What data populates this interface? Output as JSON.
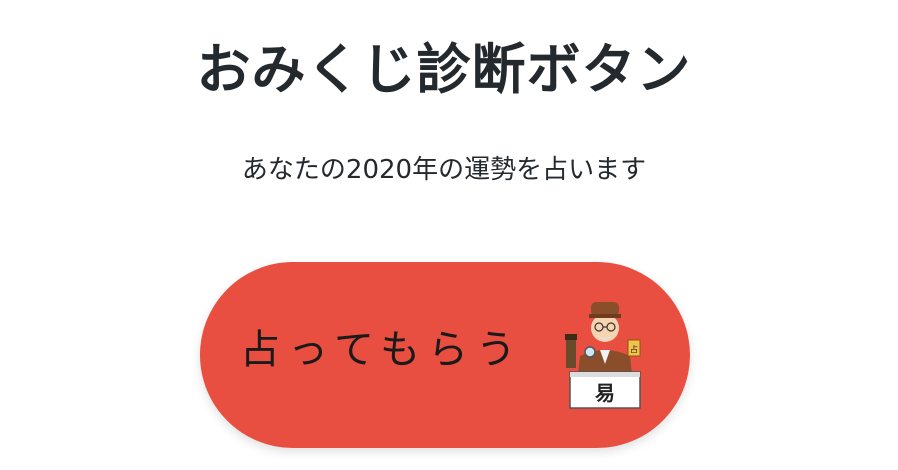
{
  "header": {
    "title": "おみくじ診断ボタン",
    "subtitle": "あなたの2020年の運勢を占います"
  },
  "button": {
    "label": "占ってもらう",
    "icon": "fortune-teller-icon",
    "sign_text": "易",
    "small_sign_text": "占"
  },
  "colors": {
    "button_background": "#e84f40",
    "text": "#24292e"
  }
}
